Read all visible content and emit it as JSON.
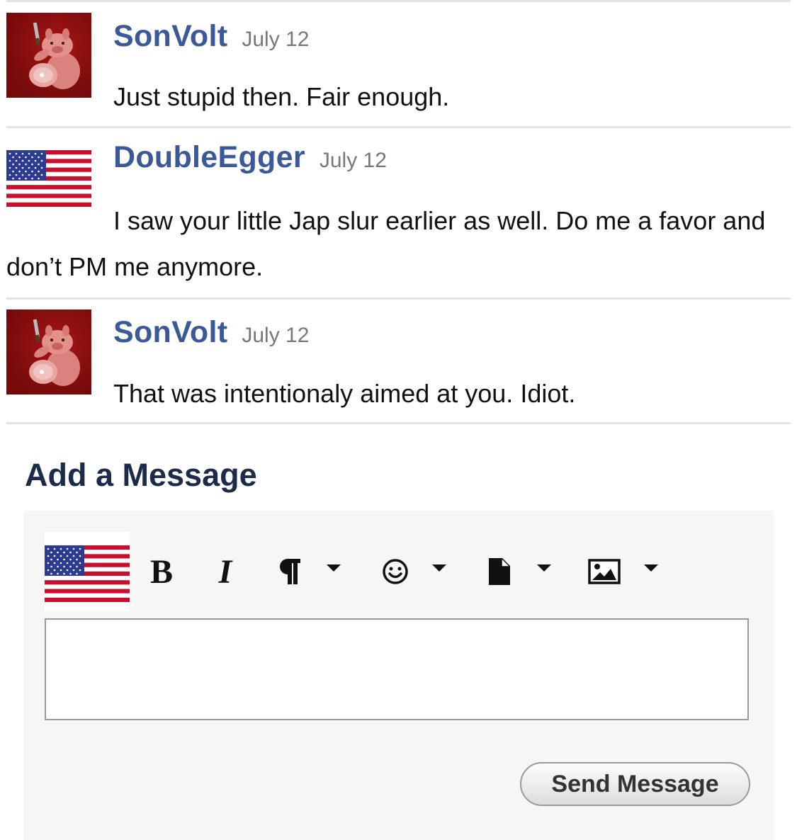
{
  "messages": [
    {
      "author": "SonVolt",
      "date": "July 12",
      "text": "Just stupid then. Fair enough.",
      "avatar": "pig-avatar"
    },
    {
      "author": "DoubleEgger",
      "date": "July 12",
      "text": "I saw your little Jap slur earlier as well. Do me a favor and don’t PM me anymore.",
      "avatar": "us-flag-avatar"
    },
    {
      "author": "SonVolt",
      "date": "July 12",
      "text": "That was intentionaly aimed at you. Idiot.",
      "avatar": "pig-avatar"
    }
  ],
  "compose": {
    "title": "Add a Message",
    "toolbar": {
      "bold_label": "B",
      "italic_label": "I",
      "icons": [
        "paragraph-icon",
        "emoji-icon",
        "file-icon",
        "image-icon",
        "chevron-down-icon"
      ]
    },
    "textarea_value": "",
    "send_label": "Send Message"
  },
  "colors": {
    "author": "#3b5998",
    "title": "#1c2b4a",
    "separator": "#e4e4e4",
    "compose_bg": "#f6f6f6"
  }
}
